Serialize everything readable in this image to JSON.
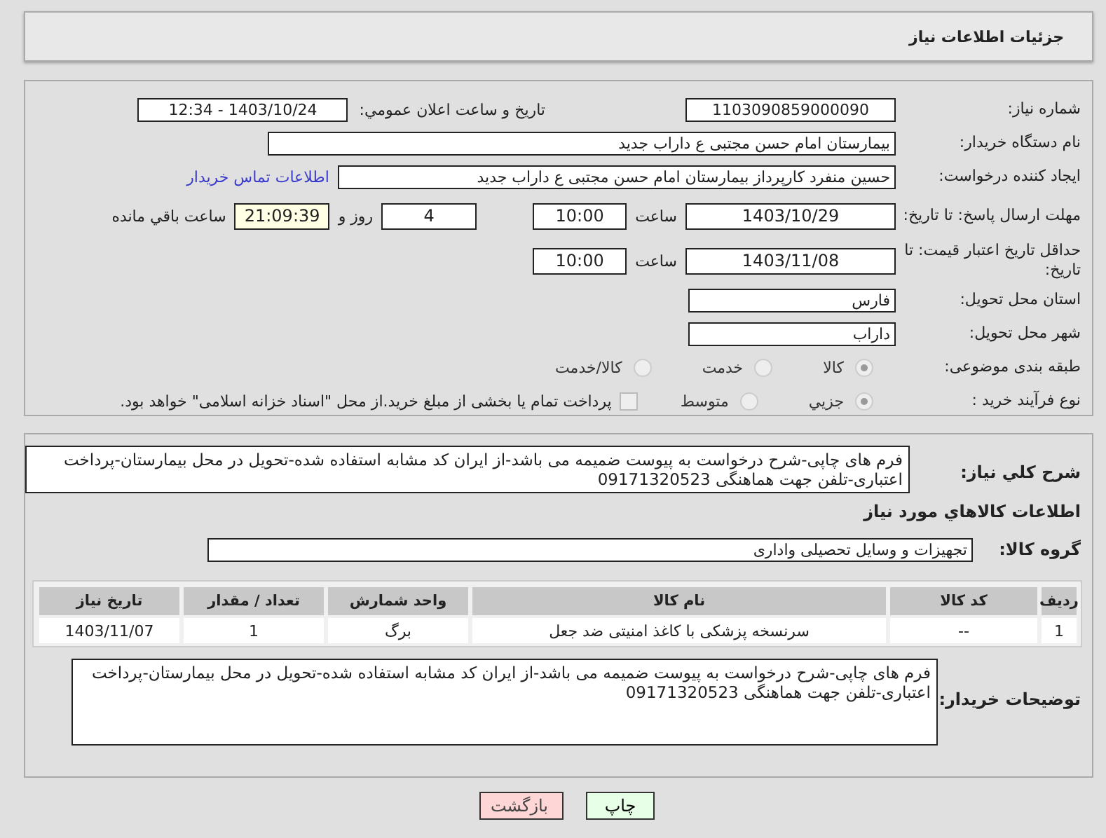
{
  "header": {
    "title": "جزئیات اطلاعات نیاز"
  },
  "need_info": {
    "need_number": {
      "label": "شماره نیاز:",
      "value": "1103090859000090"
    },
    "announce": {
      "label": "تاریخ و ساعت اعلان عمومي:",
      "value": "1403/10/24 - 12:34"
    },
    "buyer_org": {
      "label": "نام دستگاه خریدار:",
      "value": "بیمارستان امام حسن مجتبی  ع  داراب جدید"
    },
    "creator": {
      "label": "ایجاد کننده درخواست:",
      "value": "حسین  منفرد کارپرداز بیمارستان امام حسن مجتبی  ع  داراب جدید",
      "link": "اطلاعات تماس خریدار"
    },
    "reply_deadline": {
      "label": "مهلت ارسال پاسخ: تا تاریخ:",
      "date": "1403/10/29",
      "time_label": "ساعت",
      "time": "10:00",
      "days": "4",
      "days_label": "روز و",
      "remaining": "21:09:39",
      "remaining_label": "ساعت باقي مانده"
    },
    "price_validity": {
      "label": "حداقل تاریخ اعتبار قیمت: تا تاریخ:",
      "date": "1403/11/08",
      "time_label": "ساعت",
      "time": "10:00"
    },
    "province": {
      "label": "استان محل تحویل:",
      "value": "فارس"
    },
    "city": {
      "label": "شهر محل تحویل:",
      "value": "داراب"
    },
    "category": {
      "label": "طبقه بندی موضوعی:",
      "options": [
        {
          "label": "کالا",
          "selected": true
        },
        {
          "label": "خدمت",
          "selected": false
        },
        {
          "label": "کالا/خدمت",
          "selected": false
        }
      ]
    },
    "process": {
      "label": "نوع فرآیند خرید :",
      "options": [
        {
          "label": "جزیي",
          "selected": true
        },
        {
          "label": "متوسط",
          "selected": false
        }
      ],
      "treasury": {
        "checked": false,
        "label": "پرداخت تمام یا بخشی از مبلغ خرید.از محل \"اسناد خزانه اسلامی\" خواهد بود."
      }
    }
  },
  "goods": {
    "description": {
      "label": "شرح کلي نیاز:",
      "value": "فرم های چاپی-شرح درخواست به پیوست ضمیمه می باشد-از ایران کد مشابه استفاده شده-تحویل در محل بیمارستان-پرداخت اعتباری-تلفن جهت هماهنگی 09171320523"
    },
    "heading": "اطلاعات کالاهاي مورد نیاز",
    "group": {
      "label": "گروه کالا:",
      "value": "تجهیزات و وسایل تحصیلی واداری"
    },
    "table": {
      "columns": [
        "ردیف",
        "کد کالا",
        "نام کالا",
        "واحد شمارش",
        "تعداد / مقدار",
        "تاریخ نیاز"
      ],
      "rows": [
        [
          "1",
          "--",
          "سرنسخه پزشکی با کاغذ امنیتی ضد جعل",
          "برگ",
          "1",
          "1403/11/07"
        ]
      ]
    },
    "buyer_notes": {
      "label": "توضیحات خریدار:",
      "value": "فرم های چاپی-شرح درخواست به پیوست ضمیمه می باشد-از ایران کد مشابه استفاده شده-تحویل در محل بیمارستان-پرداخت اعتباری-تلفن جهت هماهنگی 09171320523"
    }
  },
  "buttons": [
    {
      "label": "چاپ",
      "kind": "print"
    },
    {
      "label": "بازگشت",
      "kind": "back"
    }
  ]
}
